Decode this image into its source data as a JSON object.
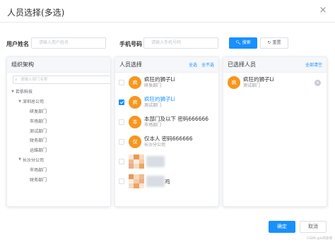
{
  "dialog": {
    "title": "人员选择(多选)",
    "close_icon": "×"
  },
  "filters": {
    "username_label": "用户姓名",
    "username_placeholder": "请输入用户姓名",
    "phone_label": "手机号码",
    "phone_placeholder": "请输入手机号码",
    "search_label": "搜索",
    "reset_label": "重置"
  },
  "org_panel": {
    "title": "组织架构",
    "search_placeholder": "请输入部门名称",
    "tree": [
      {
        "label": "若依科技",
        "level": 0,
        "expanded": true
      },
      {
        "label": "深圳总公司",
        "level": 1,
        "expanded": true
      },
      {
        "label": "研发部门",
        "level": 2
      },
      {
        "label": "市场部门",
        "level": 2
      },
      {
        "label": "测试部门",
        "level": 2
      },
      {
        "label": "财务部门",
        "level": 2
      },
      {
        "label": "运维部门",
        "level": 2
      },
      {
        "label": "长沙分公司",
        "level": 1,
        "expanded": true
      },
      {
        "label": "市场部门",
        "level": 2
      },
      {
        "label": "财务部门",
        "level": 2
      }
    ]
  },
  "people_panel": {
    "title": "人员选择",
    "select_all": "全选",
    "select_none": "全不选",
    "people": [
      {
        "avatar": "疯",
        "name": "疯狂的狮子Li",
        "dept": "研发部门",
        "checked": false,
        "highlight": false
      },
      {
        "avatar": "疯",
        "name": "疯狂的狮子Li",
        "dept": "测试部门",
        "checked": true,
        "highlight": true
      },
      {
        "avatar": "本",
        "name": "本部门及以下 密码666666",
        "dept": "市场部门",
        "checked": false,
        "highlight": false
      },
      {
        "avatar": "仅",
        "name": "仅本人 密码666666",
        "dept": "长沙分公司",
        "checked": false,
        "highlight": false
      },
      {
        "avatar": "",
        "name": "",
        "dept": "",
        "checked": false,
        "highlight": false,
        "masked": true
      },
      {
        "avatar": "",
        "name": "鸡",
        "dept": "",
        "checked": false,
        "highlight": false,
        "masked": true
      }
    ]
  },
  "selected_panel": {
    "title": "已选择人员",
    "clear_all": "全部清空",
    "people": [
      {
        "avatar": "疯",
        "name": "疯狂的狮子Li",
        "dept": "测试部门"
      }
    ]
  },
  "footer": {
    "confirm_label": "确定",
    "cancel_label": "取消"
  },
  "watermark": "CSDN @lx的思博",
  "colors": {
    "primary": "#1890ff",
    "avatar": "#f7961e"
  }
}
